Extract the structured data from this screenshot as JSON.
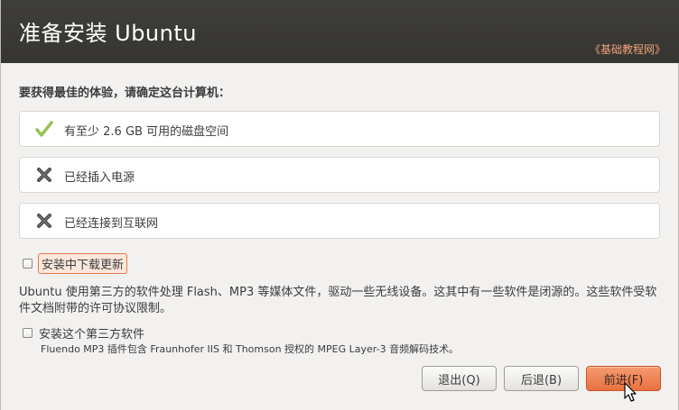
{
  "header": {
    "title": "准备安装 Ubuntu",
    "watermark": "《基础教程网》"
  },
  "prompt": "要获得最佳的体验，请确定这台计算机：",
  "requirements": [
    {
      "label": "有至少 2.6 GB 可用的磁盘空间",
      "status": "met",
      "icon": "check-icon",
      "color": "#7fb030"
    },
    {
      "label": "已经插入电源",
      "status": "unmet",
      "icon": "cross-icon",
      "color": "#4a4a4a"
    },
    {
      "label": "已经连接到互联网",
      "status": "unmet",
      "icon": "cross-icon",
      "color": "#4a4a4a"
    }
  ],
  "download_updates": {
    "label": "安装中下载更新",
    "checked": false
  },
  "third_party": {
    "description": "Ubuntu 使用第三方的软件处理 Flash、MP3 等媒体文件，驱动一些无线设备。这其中有一些软件是闭源的。这些软件受软件文档附带的许可协议限制。",
    "checkbox_label": "安装这个第三方软件",
    "checked": false,
    "note": "Fluendo MP3 插件包含 Fraunhofer IIS 和 Thomson 授权的 MPEG Layer-3 音频解码技术。"
  },
  "buttons": {
    "quit": "退出(Q)",
    "back": "后退(B)",
    "forward": "前进(F)"
  },
  "colors": {
    "header_bg": "#3a3936",
    "accent": "#e8723f",
    "window_bg": "#f2f1f0"
  }
}
